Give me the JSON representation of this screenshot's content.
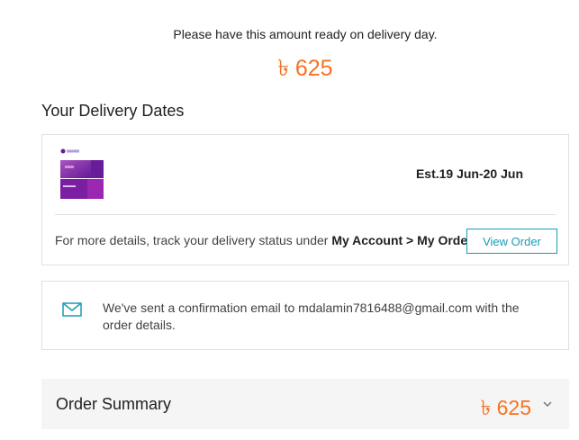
{
  "cod": {
    "note": "Please have this amount ready on delivery day.",
    "amount": "৳ 625"
  },
  "delivery": {
    "section_title": "Your Delivery Dates",
    "estimate": "Est.19 Jun-20 Jun",
    "track_prefix": "For more details, track your delivery status under ",
    "track_path": "My Account > My Order",
    "view_order_label": "View Order"
  },
  "email": {
    "message": "We've sent a confirmation email to mdalamin7816488@gmail.com with the order details.",
    "icon": "mail-icon"
  },
  "summary": {
    "title": "Order Summary",
    "amount": "৳ 625",
    "icon": "chevron-down-icon"
  },
  "colors": {
    "accent": "#f57224",
    "link": "#1a9cb7",
    "border": "#e0e0e0",
    "summary_bg": "#f5f5f5"
  }
}
